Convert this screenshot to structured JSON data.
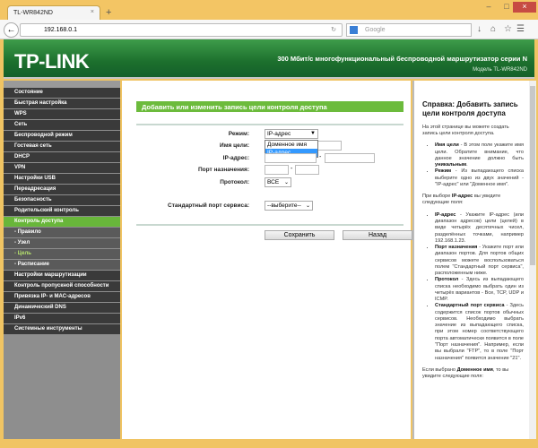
{
  "browser": {
    "tab_title": "TL-WR842ND",
    "url": "192.168.0.1",
    "search_placeholder": "Google"
  },
  "header": {
    "logo": "TP-LINK",
    "title": "300 Мбит/с многофункциональный беспроводной маршрутизатор серии N",
    "model": "Модель TL-WR842ND"
  },
  "sidebar": {
    "items": [
      "Состояние",
      "Быстрая настройка",
      "WPS",
      "Сеть",
      "Беспроводной режим",
      "Гостевая сеть",
      "DHCP",
      "VPN",
      "Настройки USB",
      "Переадресация",
      "Безопасность",
      "Родительский контроль",
      "Контроль доступа",
      "- Правило",
      "- Узел",
      "- Цель",
      "- Расписание",
      "Настройки маршрутизации",
      "Контроль пропускной способности",
      "Привязка IP- и MAC-адресов",
      "Динамический DNS",
      "IPv6",
      "Системные инструменты"
    ]
  },
  "form": {
    "title": "Добавить или изменить запись цели контроля доступа",
    "mode_label": "Режим:",
    "mode_value": "IP-адрес",
    "mode_options": [
      "Доменное имя",
      "IP-адрес"
    ],
    "target_name_label": "Имя цели:",
    "ip_label": "IP-адрес:",
    "port_label": "Порт назначения:",
    "protocol_label": "Протокол:",
    "protocol_value": "ВСЕ",
    "service_label": "Стандартный порт сервиса:",
    "service_value": "--выберите--",
    "save": "Сохранить",
    "back": "Назад",
    "dash": "-"
  },
  "help": {
    "title": "Справка: Добавить запись цели контроля доступа",
    "intro": "На этой странице вы можете создать запись цели контроля доступа.",
    "items1": [
      {
        "term": "Имя цели",
        "text": " - В этом поле укажите имя цели. Обратите внимание, что данное значение должно быть ",
        "bold2": "уникальным",
        "text2": "."
      },
      {
        "term": "Режим",
        "text": " - Из выпадающего списка выберите одно из двух значений - \"IP-адрес\" или \"Доменное имя\".",
        "bold2": "",
        "text2": ""
      }
    ],
    "ip_intro_a": "При выборе ",
    "ip_intro_b": "IP-адрес",
    "ip_intro_c": " вы увидите следующие поля:",
    "items2": [
      {
        "term": "IP-адрес",
        "text": " - Укажите IP-адрес (или диапазон адресов) цели (целей) в виде четырёх десятичных чисел, разделённых точками, например 192.168.1.23."
      },
      {
        "term": "Порт назначения",
        "text": " - Укажите порт или диапазон портов. Для портов общих сервисов можете воспользоваться полем \"Стандартный порт сервиса\", расположенным ниже."
      },
      {
        "term": "Протокол",
        "text": " - Здесь из выпадающего списка необходимо выбрать один из четырёх вариантов - Все, TCP, UDP и ICMP."
      },
      {
        "term": "Стандартный порт сервиса",
        "text": " - Здесь содержится список портов обычных сервисов. Необходимо выбрать значение из выпадающего списка, при этом номер соответствующего порта автоматически появится в поле \"Порт назначения\". Например, если вы выбрали \"FTP\", то в поле \"Порт назначения\" появится значение \"21\"."
      }
    ],
    "domain_a": "Если выбрано ",
    "domain_b": "Доменное имя",
    "domain_c": ", то вы увидите следующие поля:"
  }
}
